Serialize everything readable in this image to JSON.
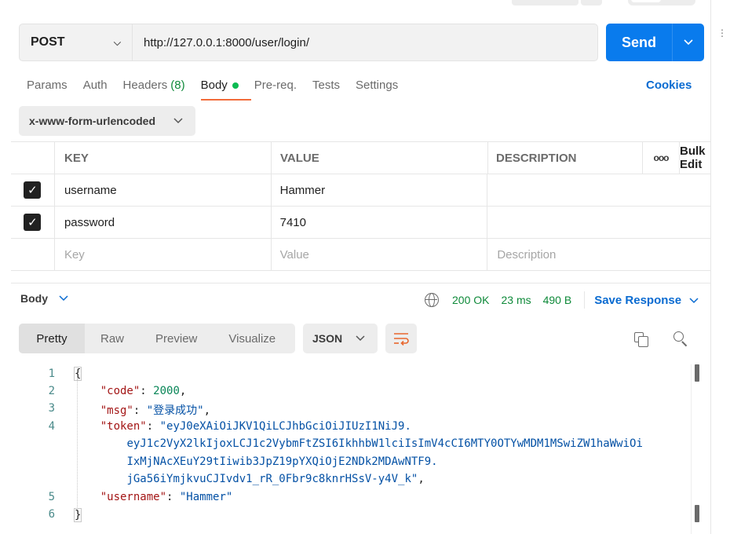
{
  "request": {
    "method": "POST",
    "url": "http://127.0.0.1:8000/user/login/",
    "send_label": "Send"
  },
  "tabs": [
    {
      "label": "Params"
    },
    {
      "label": "Auth"
    },
    {
      "label": "Headers",
      "count": "(8)"
    },
    {
      "label": "Body"
    },
    {
      "label": "Pre-req."
    },
    {
      "label": "Tests"
    },
    {
      "label": "Settings"
    }
  ],
  "cookies_label": "Cookies",
  "body_type": "x-www-form-urlencoded",
  "params": {
    "headers": {
      "key": "KEY",
      "value": "VALUE",
      "description": "DESCRIPTION",
      "more": "ooo",
      "bulk_edit": "Bulk Edit"
    },
    "rows": [
      {
        "key": "username",
        "value": "Hammer",
        "checked": true
      },
      {
        "key": "password",
        "value": "7410",
        "checked": true
      }
    ],
    "placeholders": {
      "key": "Key",
      "value": "Value",
      "description": "Description"
    }
  },
  "response": {
    "section_label": "Body",
    "status": "200 OK",
    "time": "23 ms",
    "size": "490 B",
    "save_label": "Save Response",
    "views": [
      "Pretty",
      "Raw",
      "Preview",
      "Visualize"
    ],
    "format": "JSON",
    "line_numbers": [
      "1",
      "2",
      "3",
      "4",
      "5",
      "6"
    ],
    "json": {
      "open": "{",
      "close": "}",
      "code_key": "\"code\"",
      "code_val": "2000",
      "msg_key": "\"msg\"",
      "msg_val": "\"登录成功\"",
      "token_key": "\"token\"",
      "token_line1": "\"eyJ0eXAiOiJKV1QiLCJhbGciOiJIUzI1NiJ9.",
      "token_line2": "eyJ1c2VyX2lkIjoxLCJ1c2VybmFtZSI6IkhhbW1lciIsImV4cCI6MTY0OTYwMDM1MSwiZW1haWwiOi",
      "token_line3": "IxMjNAcXEuY29tIiwib3JpZ19pYXQiOjE2NDk2MDAwNTF9.",
      "token_line4": "jGa56iYmjkvuCJIvdv1_rR_0Fbr9c8knrHSsV-y4V_k\"",
      "username_key": "\"username\"",
      "username_val": "\"Hammer\""
    }
  }
}
